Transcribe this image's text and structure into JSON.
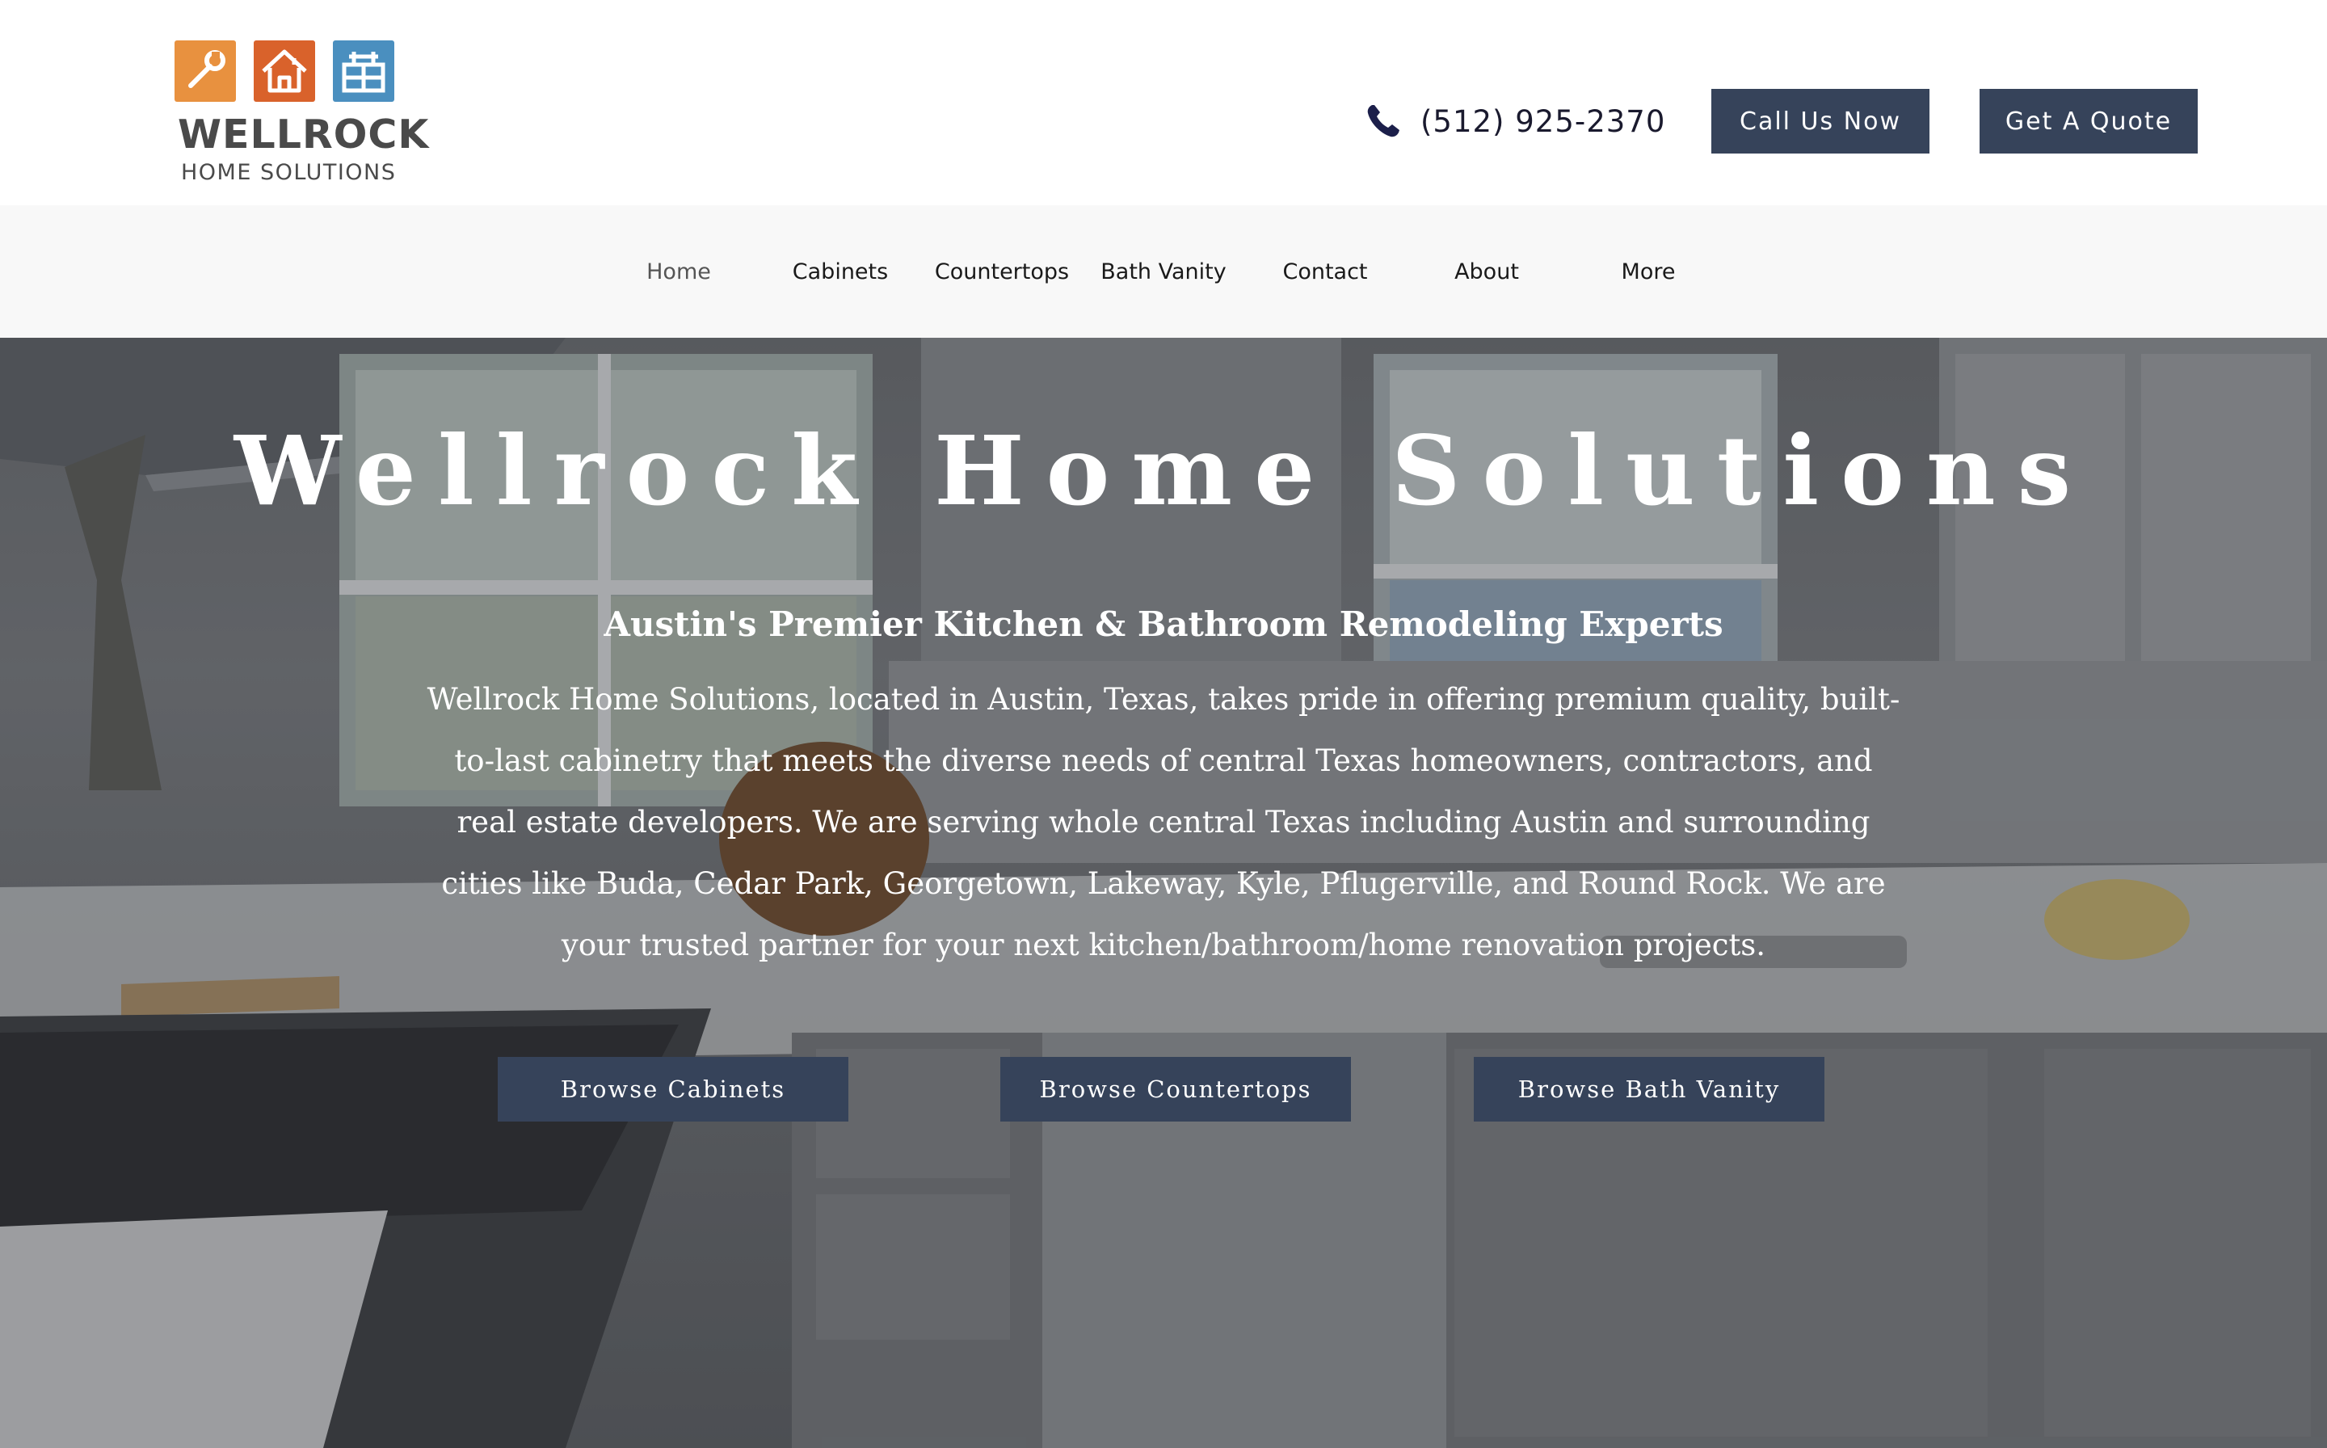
{
  "header": {
    "logo_word": "WELLROCK",
    "logo_sub": "HOME SOLUTIONS",
    "logo_icons": [
      "wrench-icon",
      "house-icon",
      "gate-icon"
    ],
    "phone": "(512) 925-2370",
    "call_label": "Call Us Now",
    "quote_label": "Get A Quote"
  },
  "nav": {
    "items": [
      {
        "label": "Home",
        "active": true
      },
      {
        "label": "Cabinets"
      },
      {
        "label": "Countertops"
      },
      {
        "label": "Bath Vanity"
      },
      {
        "label": "Contact"
      },
      {
        "label": "About"
      },
      {
        "label": "More"
      }
    ]
  },
  "hero": {
    "title": "Wellrock Home Solutions",
    "subtitle": "Austin's Premier Kitchen & Bathroom Remodeling Experts",
    "body": "Wellrock Home Solutions, located in Austin, Texas, takes pride in offering premium quality, built-to-last cabinetry that meets the diverse needs of central Texas homeowners, contractors, and real estate developers. We are serving whole central Texas including Austin and surrounding cities like Buda, Cedar Park, Georgetown, Lakeway, Kyle, Pflugerville, and Round Rock. We are your trusted partner for your next kitchen/bathroom/home renovation projects.",
    "buttons": [
      "Browse Cabinets",
      "Browse Countertops",
      "Browse Bath Vanity"
    ]
  },
  "colors": {
    "button_bg": "#36435a",
    "logo_orange": "#e8913f",
    "logo_red": "#d9622b",
    "logo_blue": "#4a8fbf",
    "nav_bg": "#f8f8f8"
  }
}
